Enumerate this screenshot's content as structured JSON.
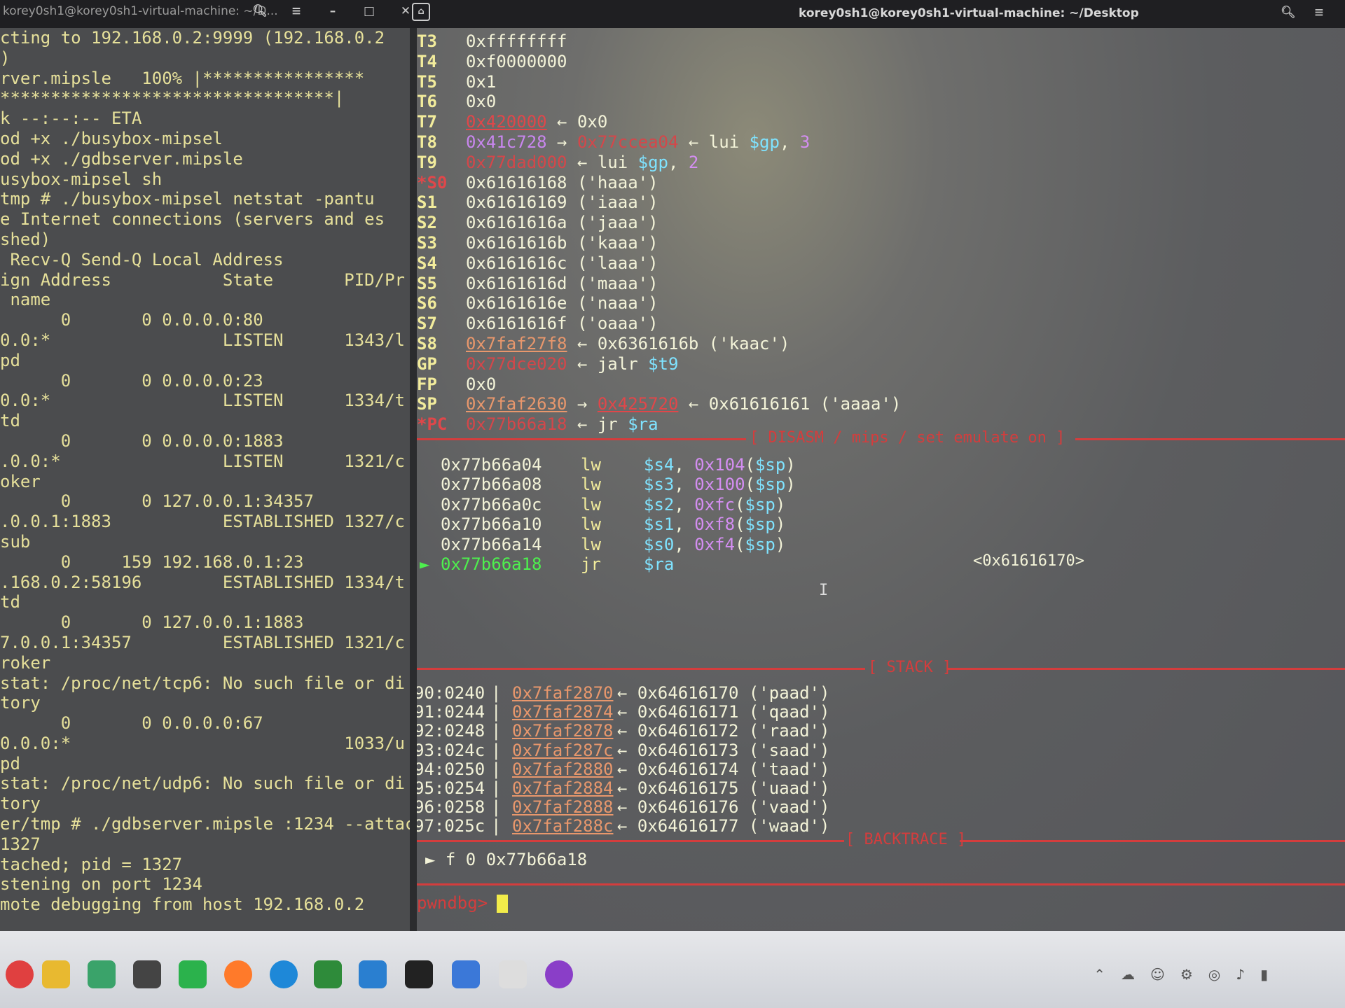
{
  "window": {
    "left_title": "korey0sh1@korey0sh1-virtual-machine: ~/D...",
    "main_title": "korey0sh1@korey0sh1-virtual-machine: ~/Desktop"
  },
  "left_terminal": {
    "lines": [
      "cting to 192.168.0.2:9999 (192.168.0.2",
      ")",
      "rver.mipsle   100% |****************",
      "*********************************|",
      "k --:--:-- ETA",
      "od +x ./busybox-mipsel",
      "od +x ./gdbserver.mipsle",
      "usybox-mipsel sh",
      "tmp # ./busybox-mipsel netstat -pantu",
      "e Internet connections (servers and es",
      "shed)",
      " Recv-Q Send-Q Local Address",
      "ign Address           State       PID/Pr",
      " name",
      "      0       0 0.0.0.0:80",
      "0.0:*                 LISTEN      1343/l",
      "pd",
      "      0       0 0.0.0.0:23",
      "0.0:*                 LISTEN      1334/t",
      "td",
      "      0       0 0.0.0.0:1883",
      ".0.0:*                LISTEN      1321/c",
      "oker",
      "      0       0 127.0.0.1:34357",
      ".0.0.1:1883           ESTABLISHED 1327/c",
      "sub",
      "      0     159 192.168.0.1:23",
      ".168.0.2:58196        ESTABLISHED 1334/t",
      "td",
      "      0       0 127.0.0.1:1883",
      "7.0.0.1:34357         ESTABLISHED 1321/c",
      "roker",
      "stat: /proc/net/tcp6: No such file or di",
      "tory",
      "      0       0 0.0.0.0:67",
      "0.0.0:*                           1033/u",
      "pd",
      "stat: /proc/net/udp6: No such file or di",
      "tory",
      "er/tmp # ./gdbserver.mipsle :1234 --attac",
      "1327",
      "tached; pid = 1327",
      "stening on port 1234",
      "mote debugging from host 192.168.0.2"
    ]
  },
  "registers": [
    {
      "name": "T3",
      "parts": [
        {
          "t": "0xffffffff",
          "c": "c-text"
        }
      ]
    },
    {
      "name": "T4",
      "parts": [
        {
          "t": "0xf0000000",
          "c": "c-text"
        }
      ]
    },
    {
      "name": "T5",
      "parts": [
        {
          "t": "0x1",
          "c": "c-text"
        }
      ]
    },
    {
      "name": "T6",
      "parts": [
        {
          "t": "0x0",
          "c": "c-text"
        }
      ]
    },
    {
      "name": "T7",
      "parts": [
        {
          "t": "0x420000",
          "c": "c-addr-red"
        },
        {
          "t": " ← 0x0",
          "c": "c-text"
        }
      ]
    },
    {
      "name": "T8",
      "parts": [
        {
          "t": "0x41c728",
          "c": "c-addr-purple"
        },
        {
          "t": " → ",
          "c": "c-text"
        },
        {
          "t": "0x77ccea04",
          "c": "c-addr-red-plain"
        },
        {
          "t": " ← lui ",
          "c": "c-text"
        },
        {
          "t": "$gp",
          "c": "c-cyan"
        },
        {
          "t": ", ",
          "c": "c-text"
        },
        {
          "t": "3",
          "c": "c-magenta"
        }
      ]
    },
    {
      "name": "T9",
      "parts": [
        {
          "t": "0x77dad000",
          "c": "c-addr-red-plain"
        },
        {
          "t": " ← lui ",
          "c": "c-text"
        },
        {
          "t": "$gp",
          "c": "c-cyan"
        },
        {
          "t": ", ",
          "c": "c-text"
        },
        {
          "t": "2",
          "c": "c-magenta"
        }
      ]
    },
    {
      "name": "*S0",
      "changed": true,
      "parts": [
        {
          "t": "0x61616168 ('haaa')",
          "c": "c-text"
        }
      ]
    },
    {
      "name": "S1",
      "parts": [
        {
          "t": "0x61616169 ('iaaa')",
          "c": "c-text"
        }
      ]
    },
    {
      "name": "S2",
      "parts": [
        {
          "t": "0x6161616a ('jaaa')",
          "c": "c-text"
        }
      ]
    },
    {
      "name": "S3",
      "parts": [
        {
          "t": "0x6161616b ('kaaa')",
          "c": "c-text"
        }
      ]
    },
    {
      "name": "S4",
      "parts": [
        {
          "t": "0x6161616c ('laaa')",
          "c": "c-text"
        }
      ]
    },
    {
      "name": "S5",
      "parts": [
        {
          "t": "0x6161616d ('maaa')",
          "c": "c-text"
        }
      ]
    },
    {
      "name": "S6",
      "parts": [
        {
          "t": "0x6161616e ('naaa')",
          "c": "c-text"
        }
      ]
    },
    {
      "name": "S7",
      "parts": [
        {
          "t": "0x6161616f ('oaaa')",
          "c": "c-text"
        }
      ]
    },
    {
      "name": "S8",
      "parts": [
        {
          "t": "0x7faf27f8",
          "c": "c-addr-orange"
        },
        {
          "t": " ← 0x6361616b ('kaac')",
          "c": "c-text"
        }
      ]
    },
    {
      "name": "GP",
      "parts": [
        {
          "t": "0x77dce020",
          "c": "c-addr-red-plain"
        },
        {
          "t": " ← jalr ",
          "c": "c-text"
        },
        {
          "t": "$t9",
          "c": "c-cyan"
        }
      ]
    },
    {
      "name": "FP",
      "parts": [
        {
          "t": "0x0",
          "c": "c-text"
        }
      ]
    },
    {
      "name": "SP",
      "parts": [
        {
          "t": "0x7faf2630",
          "c": "c-addr-orange"
        },
        {
          "t": " → ",
          "c": "c-text"
        },
        {
          "t": "0x425720",
          "c": "c-addr-red"
        },
        {
          "t": " ← 0x61616161 ('aaaa')",
          "c": "c-text"
        }
      ]
    },
    {
      "name": "*PC",
      "changed": true,
      "parts": [
        {
          "t": "0x77b66a18",
          "c": "c-addr-red-plain"
        },
        {
          "t": " ← jr ",
          "c": "c-text"
        },
        {
          "t": "$ra",
          "c": "c-cyan"
        }
      ]
    }
  ],
  "disasm": {
    "header": "[ DISASM / mips / set emulate on ]",
    "rows": [
      {
        "addr": "0x77b66a04",
        "op": "lw",
        "args": [
          {
            "t": "$s4",
            "c": "c-cyan"
          },
          {
            "t": ", ",
            "c": "c-text"
          },
          {
            "t": "0x104",
            "c": "c-magenta"
          },
          {
            "t": "(",
            "c": "c-text"
          },
          {
            "t": "$sp",
            "c": "c-cyan"
          },
          {
            "t": ")",
            "c": "c-text"
          }
        ]
      },
      {
        "addr": "0x77b66a08",
        "op": "lw",
        "args": [
          {
            "t": "$s3",
            "c": "c-cyan"
          },
          {
            "t": ", ",
            "c": "c-text"
          },
          {
            "t": "0x100",
            "c": "c-magenta"
          },
          {
            "t": "(",
            "c": "c-text"
          },
          {
            "t": "$sp",
            "c": "c-cyan"
          },
          {
            "t": ")",
            "c": "c-text"
          }
        ]
      },
      {
        "addr": "0x77b66a0c",
        "op": "lw",
        "args": [
          {
            "t": "$s2",
            "c": "c-cyan"
          },
          {
            "t": ", ",
            "c": "c-text"
          },
          {
            "t": "0xfc",
            "c": "c-magenta"
          },
          {
            "t": "(",
            "c": "c-text"
          },
          {
            "t": "$sp",
            "c": "c-cyan"
          },
          {
            "t": ")",
            "c": "c-text"
          }
        ]
      },
      {
        "addr": "0x77b66a10",
        "op": "lw",
        "args": [
          {
            "t": "$s1",
            "c": "c-cyan"
          },
          {
            "t": ", ",
            "c": "c-text"
          },
          {
            "t": "0xf8",
            "c": "c-magenta"
          },
          {
            "t": "(",
            "c": "c-text"
          },
          {
            "t": "$sp",
            "c": "c-cyan"
          },
          {
            "t": ")",
            "c": "c-text"
          }
        ]
      },
      {
        "addr": "0x77b66a14",
        "op": "lw",
        "args": [
          {
            "t": "$s0",
            "c": "c-cyan"
          },
          {
            "t": ", ",
            "c": "c-text"
          },
          {
            "t": "0xf4",
            "c": "c-magenta"
          },
          {
            "t": "(",
            "c": "c-text"
          },
          {
            "t": "$sp",
            "c": "c-cyan"
          },
          {
            "t": ")",
            "c": "c-text"
          }
        ]
      },
      {
        "addr": "0x77b66a18",
        "op": "jr",
        "current": true,
        "args": [
          {
            "t": "$ra",
            "c": "c-cyan"
          }
        ],
        "target": "<0x61616170>"
      }
    ]
  },
  "stack": {
    "header": "[ STACK ]",
    "rows": [
      {
        "off": "90:0240",
        "addr": "0x7faf2870",
        "rest": "← 0x64616170 ('paad')"
      },
      {
        "off": "91:0244",
        "addr": "0x7faf2874",
        "rest": "← 0x64616171 ('qaad')"
      },
      {
        "off": "92:0248",
        "addr": "0x7faf2878",
        "rest": "← 0x64616172 ('raad')"
      },
      {
        "off": "93:024c",
        "addr": "0x7faf287c",
        "rest": "← 0x64616173 ('saad')"
      },
      {
        "off": "94:0250",
        "addr": "0x7faf2880",
        "rest": "← 0x64616174 ('taad')"
      },
      {
        "off": "95:0254",
        "addr": "0x7faf2884",
        "rest": "← 0x64616175 ('uaad')"
      },
      {
        "off": "96:0258",
        "addr": "0x7faf2888",
        "rest": "← 0x64616176 ('vaad')"
      },
      {
        "off": "97:025c",
        "addr": "0x7faf288c",
        "rest": "← 0x64616177 ('waad')"
      }
    ]
  },
  "backtrace": {
    "header": "[ BACKTRACE ]",
    "frame": "► f 0 0x77b66a18"
  },
  "prompt": {
    "label": "pwndbg>"
  },
  "taskbar": {
    "icons": [
      "notification-icon",
      "file-explorer-icon",
      "folder-icon",
      "app-cube-icon",
      "wechat-icon",
      "firefox-icon",
      "edge-icon",
      "ie-icon",
      "vm-icon",
      "terminal-icon",
      "notepad-icon",
      "avatar-app-icon",
      "chat-app-icon"
    ],
    "colors": {
      "accent": "#d43d3d",
      "register": "#f2ec9c",
      "current": "#4ef04e"
    }
  }
}
